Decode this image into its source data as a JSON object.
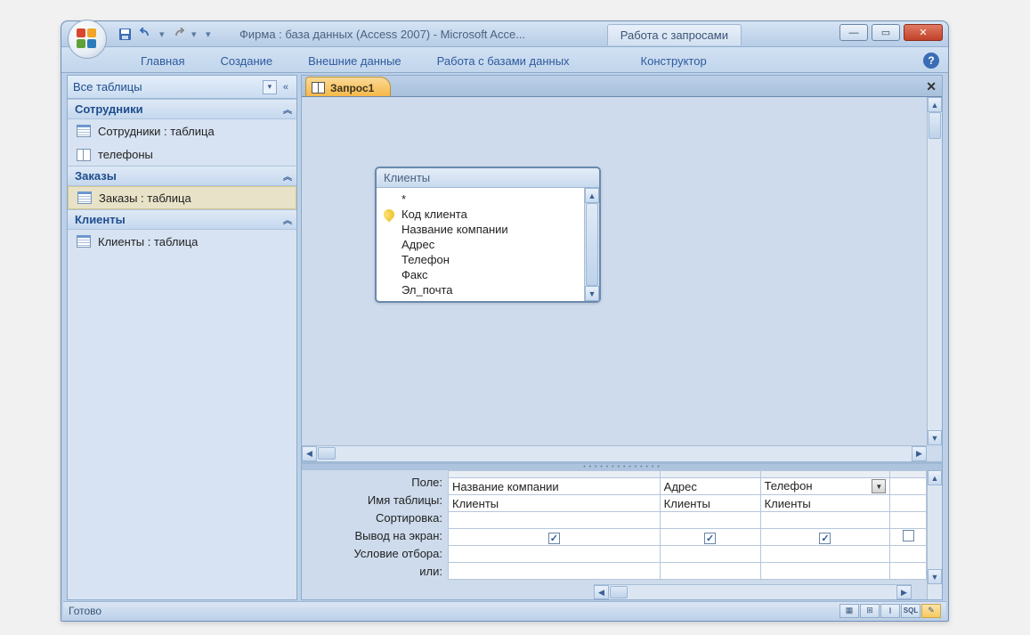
{
  "title": "Фирма : база данных (Access 2007) - Microsoft Acce...",
  "context_tab": "Работа с запросами",
  "ribbon": {
    "tabs": [
      "Главная",
      "Создание",
      "Внешние данные",
      "Работа с базами данных"
    ],
    "context": "Конструктор"
  },
  "nav": {
    "header": "Все таблицы",
    "groups": [
      {
        "title": "Сотрудники",
        "items": [
          {
            "label": "Сотрудники : таблица",
            "icon": "table"
          },
          {
            "label": "телефоны",
            "icon": "query"
          }
        ]
      },
      {
        "title": "Заказы",
        "items": [
          {
            "label": "Заказы : таблица",
            "icon": "table",
            "selected": true
          }
        ]
      },
      {
        "title": "Клиенты",
        "items": [
          {
            "label": "Клиенты : таблица",
            "icon": "table"
          }
        ]
      }
    ]
  },
  "doc": {
    "tab": "Запрос1"
  },
  "tablebox": {
    "title": "Клиенты",
    "fields": [
      "*",
      "Код клиента",
      "Название компании",
      "Адрес",
      "Телефон",
      "Факс",
      "Эл_почта"
    ],
    "key_index": 1
  },
  "grid": {
    "labels": [
      "Поле:",
      "Имя таблицы:",
      "Сортировка:",
      "Вывод на экран:",
      "Условие отбора:",
      "или:"
    ],
    "cols": [
      {
        "field": "Название компании",
        "table": "Клиенты",
        "show": true
      },
      {
        "field": "Адрес",
        "table": "Клиенты",
        "show": true
      },
      {
        "field": "Телефон",
        "table": "Клиенты",
        "show": true,
        "dropdown": true
      }
    ]
  },
  "status": "Готово",
  "view_labels": [
    "datasheet",
    "pivot-table",
    "pivot-chart",
    "sql",
    "design"
  ]
}
